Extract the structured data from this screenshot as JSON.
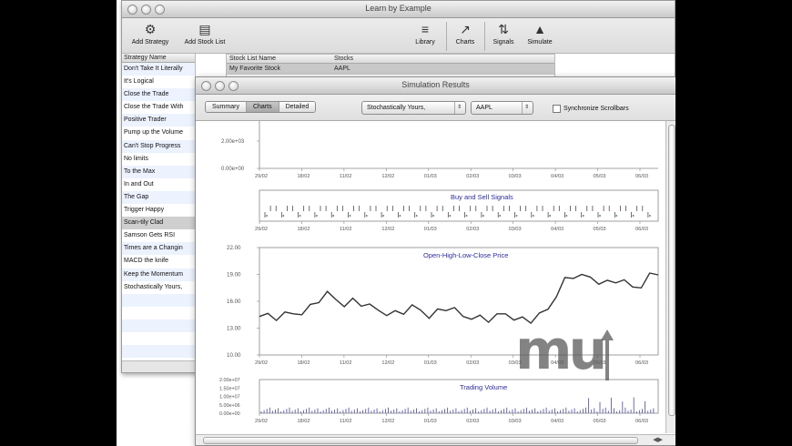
{
  "back_window": {
    "title": "Learn by Example",
    "toolbar": [
      {
        "label": "Add Strategy",
        "icon": "strategy-icon"
      },
      {
        "label": "Add Stock List",
        "icon": "stock-list-icon"
      },
      {
        "label": "Library",
        "icon": "library-icon"
      },
      {
        "label": "Charts",
        "icon": "charts-icon"
      },
      {
        "label": "Signals",
        "icon": "signals-icon"
      },
      {
        "label": "Simulate",
        "icon": "simulate-icon"
      }
    ],
    "strategy_header": "Strategy Name",
    "strategies": [
      "Don't Take It Literally",
      "It's Logical",
      "Close the Trade",
      "Close the Trade With",
      "Positive Trader",
      "Pump up the Volume",
      "Can't Stop Progress",
      "No limits",
      "To the Max",
      "In and Out",
      "The Gap",
      "Trigger Happy",
      "Scan-tily Clad",
      "Samson Gets RSI",
      "Times are a Changin",
      "MACD the knife",
      "Keep the Momentum",
      "Stochastically Yours,",
      "",
      "",
      "",
      "",
      "",
      ""
    ],
    "selected_strategy_index": 12,
    "stock_list_headers": [
      "Stock List Name",
      "Stocks"
    ],
    "stock_list_rows": [
      [
        "My Favorite Stock",
        "AAPL"
      ]
    ]
  },
  "front_window": {
    "title": "Simulation Results",
    "segments": [
      "Summary",
      "Charts",
      "Detailed"
    ],
    "selected_segment": "Charts",
    "strategy_popup": "Stochastically Yours,",
    "symbol_popup": "AAPL",
    "sync_label": "Synchronize Scrollbars",
    "sync_checked": false
  },
  "chart_data": [
    {
      "type": "line",
      "title": "",
      "y_ticks": [
        "2.00e+03",
        "0.00e+00"
      ],
      "x_ticks": [
        "29/02",
        "18/02",
        "11/02",
        "12/02",
        "01/03",
        "02/03",
        "03/03",
        "04/03",
        "05/03",
        "06/03"
      ]
    },
    {
      "type": "scatter",
      "title": "Buy and Sell Signals",
      "x_ticks": [
        "29/02",
        "18/02",
        "11/02",
        "12/02",
        "01/03",
        "02/03",
        "03/03",
        "04/03",
        "05/03",
        "06/03"
      ]
    },
    {
      "type": "line",
      "title": "Open-High-Low-Close Price",
      "ylim": [
        10,
        22
      ],
      "y_ticks": [
        "22.00",
        "19.00",
        "16.00",
        "13.00",
        "10.00"
      ],
      "x_ticks": [
        "29/02",
        "18/02",
        "11/02",
        "12/02",
        "01/03",
        "02/03",
        "03/03",
        "04/03",
        "05/03",
        "06/03"
      ],
      "series": [
        {
          "values": [
            14.8,
            14.4,
            14.1,
            14.3,
            14.6,
            15.0,
            15.4,
            16.1,
            16.6,
            16.2,
            15.9,
            16.1,
            15.7,
            15.2,
            15.0,
            14.9,
            14.7,
            14.8,
            15.1,
            15.0,
            14.6,
            14.9,
            15.2,
            14.8,
            14.3,
            14.5,
            14.2,
            13.9,
            14.1,
            14.6,
            14.4,
            14.0,
            13.8,
            14.2,
            15.1,
            17.0,
            18.4,
            18.8,
            18.5,
            18.7,
            18.4,
            18.1,
            18.3,
            17.9,
            17.6,
            18.0,
            18.9,
            19.2
          ]
        }
      ]
    },
    {
      "type": "bar",
      "title": "Trading Volume",
      "y_ticks": [
        "2.00e+07",
        "1.50e+07",
        "1.00e+07",
        "5.00e+06",
        "0.00e+00"
      ],
      "x_ticks": [
        "29/02",
        "18/02",
        "11/02",
        "12/02",
        "01/03",
        "02/03",
        "03/03",
        "04/03",
        "05/03",
        "06/03"
      ]
    }
  ],
  "watermark": "mu"
}
